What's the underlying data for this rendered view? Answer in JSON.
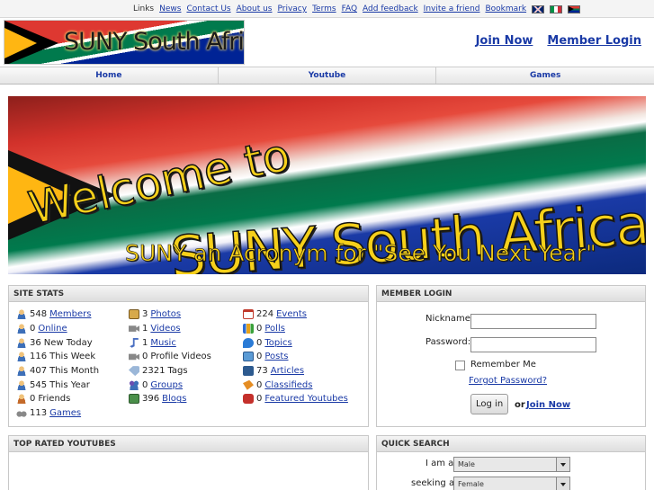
{
  "topbar": {
    "links_label": "Links",
    "links": [
      "News",
      "Contact Us",
      "About us",
      "Privacy",
      "Terms",
      "FAQ",
      "Add feedback",
      "Invite a friend",
      "Bookmark"
    ],
    "flags": [
      "uk-flag-icon",
      "italy-flag-icon",
      "south-africa-flag-icon"
    ]
  },
  "header": {
    "logo_text": "SUNY South Africa",
    "join_now": "Join Now",
    "member_login": "Member Login"
  },
  "nav": {
    "items": [
      "Home",
      "Youtube",
      "Games"
    ]
  },
  "banner": {
    "line1": "Welcome to",
    "line2": "SUNY South Africa",
    "line3": "SUNY an Acronym for \"See You Next Year\""
  },
  "site_stats": {
    "title": "SITE STATS",
    "col1": [
      {
        "icon": "members-icon",
        "count": "548",
        "label": "Members",
        "link": true
      },
      {
        "icon": "online-icon",
        "count": "0",
        "label": "Online",
        "link": true
      },
      {
        "icon": "new-today-icon",
        "count": "36",
        "label": "New Today",
        "link": false
      },
      {
        "icon": "this-week-icon",
        "count": "116",
        "label": "This Week",
        "link": false
      },
      {
        "icon": "this-month-icon",
        "count": "407",
        "label": "This Month",
        "link": false
      },
      {
        "icon": "this-year-icon",
        "count": "545",
        "label": "This Year",
        "link": false
      },
      {
        "icon": "friends-icon",
        "count": "0",
        "label": "Friends",
        "link": false
      },
      {
        "icon": "games-icon",
        "count": "113",
        "label": "Games",
        "link": true
      }
    ],
    "col2": [
      {
        "icon": "photos-icon",
        "count": "3",
        "label": "Photos",
        "link": true
      },
      {
        "icon": "videos-icon",
        "count": "1",
        "label": "Videos",
        "link": true
      },
      {
        "icon": "music-icon",
        "count": "1",
        "label": "Music",
        "link": true
      },
      {
        "icon": "profile-videos-icon",
        "count": "0",
        "label": "Profile Videos",
        "link": false
      },
      {
        "icon": "tags-icon",
        "count": "2321",
        "label": "Tags",
        "link": false
      },
      {
        "icon": "groups-icon",
        "count": "0",
        "label": "Groups",
        "link": true
      },
      {
        "icon": "blogs-icon",
        "count": "396",
        "label": "Blogs",
        "link": true
      }
    ],
    "col3": [
      {
        "icon": "events-icon",
        "count": "224",
        "label": "Events",
        "link": true
      },
      {
        "icon": "polls-icon",
        "count": "0",
        "label": "Polls",
        "link": true
      },
      {
        "icon": "topics-icon",
        "count": "0",
        "label": "Topics",
        "link": true
      },
      {
        "icon": "posts-icon",
        "count": "0",
        "label": "Posts",
        "link": true
      },
      {
        "icon": "articles-icon",
        "count": "73",
        "label": "Articles",
        "link": true
      },
      {
        "icon": "classifieds-icon",
        "count": "0",
        "label": "Classifieds",
        "link": true
      },
      {
        "icon": "youtube-icon",
        "count": "0",
        "label": "Featured Youtubes",
        "link": true
      }
    ]
  },
  "member_login": {
    "title": "MEMBER LOGIN",
    "nickname_label": "Nickname:",
    "password_label": "Password:",
    "remember_me": "Remember Me",
    "forgot_password": "Forgot Password?",
    "login_button": "Log in",
    "or_text": "or",
    "join_now": "Join Now"
  },
  "top_rated": {
    "title": "TOP RATED YOUTUBES"
  },
  "quick_search": {
    "title": "QUICK SEARCH",
    "i_am_label": "I am a",
    "i_am_value": "Male",
    "seeking_label": "seeking a",
    "seeking_value": "Female"
  }
}
